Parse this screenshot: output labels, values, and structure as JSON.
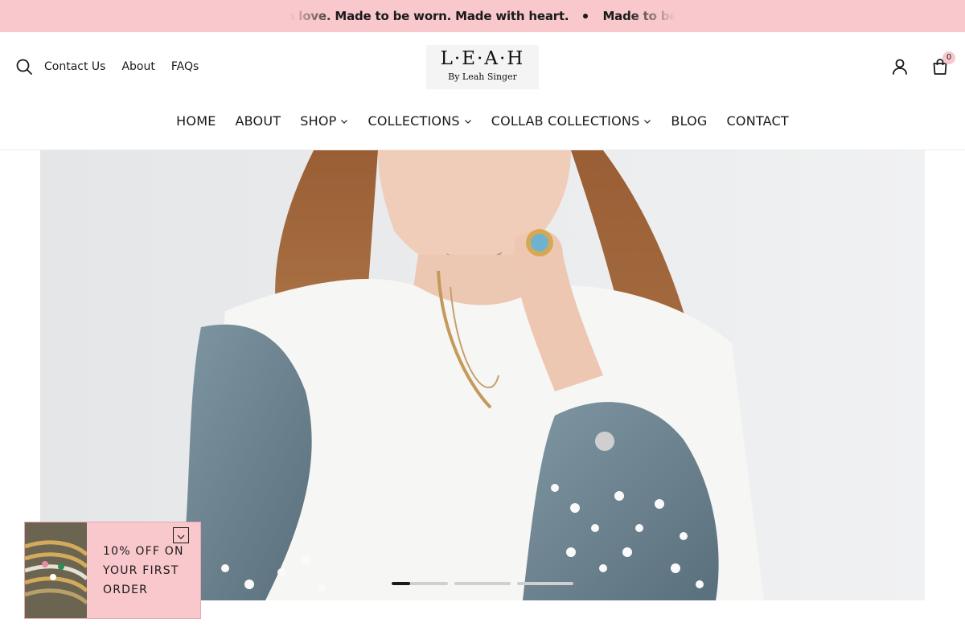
{
  "announcement": {
    "messages": [
      "Made with love. Made to be worn. Made with heart.",
      "Made to be worn. Made to be loved. Made with heart."
    ]
  },
  "utility_nav": {
    "links": [
      "Contact Us",
      "About",
      "FAQs"
    ]
  },
  "logo": {
    "main": "L·E·A·H",
    "sub": "By Leah Singer"
  },
  "cart": {
    "count": "0"
  },
  "main_nav": {
    "items": [
      {
        "label": "HOME",
        "has_dropdown": false
      },
      {
        "label": "ABOUT",
        "has_dropdown": false
      },
      {
        "label": "SHOP",
        "has_dropdown": true
      },
      {
        "label": "COLLECTIONS",
        "has_dropdown": true
      },
      {
        "label": "COLLAB COLLECTIONS",
        "has_dropdown": true
      },
      {
        "label": "BLOG",
        "has_dropdown": false
      },
      {
        "label": "CONTACT",
        "has_dropdown": false
      }
    ]
  },
  "hero": {
    "slide_count": 3,
    "active_slide": 1,
    "active_progress": 0.33
  },
  "promo": {
    "line1": "10% OFF ON",
    "line2": "YOUR FIRST",
    "line3": "ORDER"
  },
  "colors": {
    "accent_pink": "#f8c8cd",
    "text": "#1a1a1a"
  },
  "icons": [
    "search-icon",
    "account-icon",
    "cart-icon",
    "chevron-down-icon",
    "close-icon"
  ]
}
